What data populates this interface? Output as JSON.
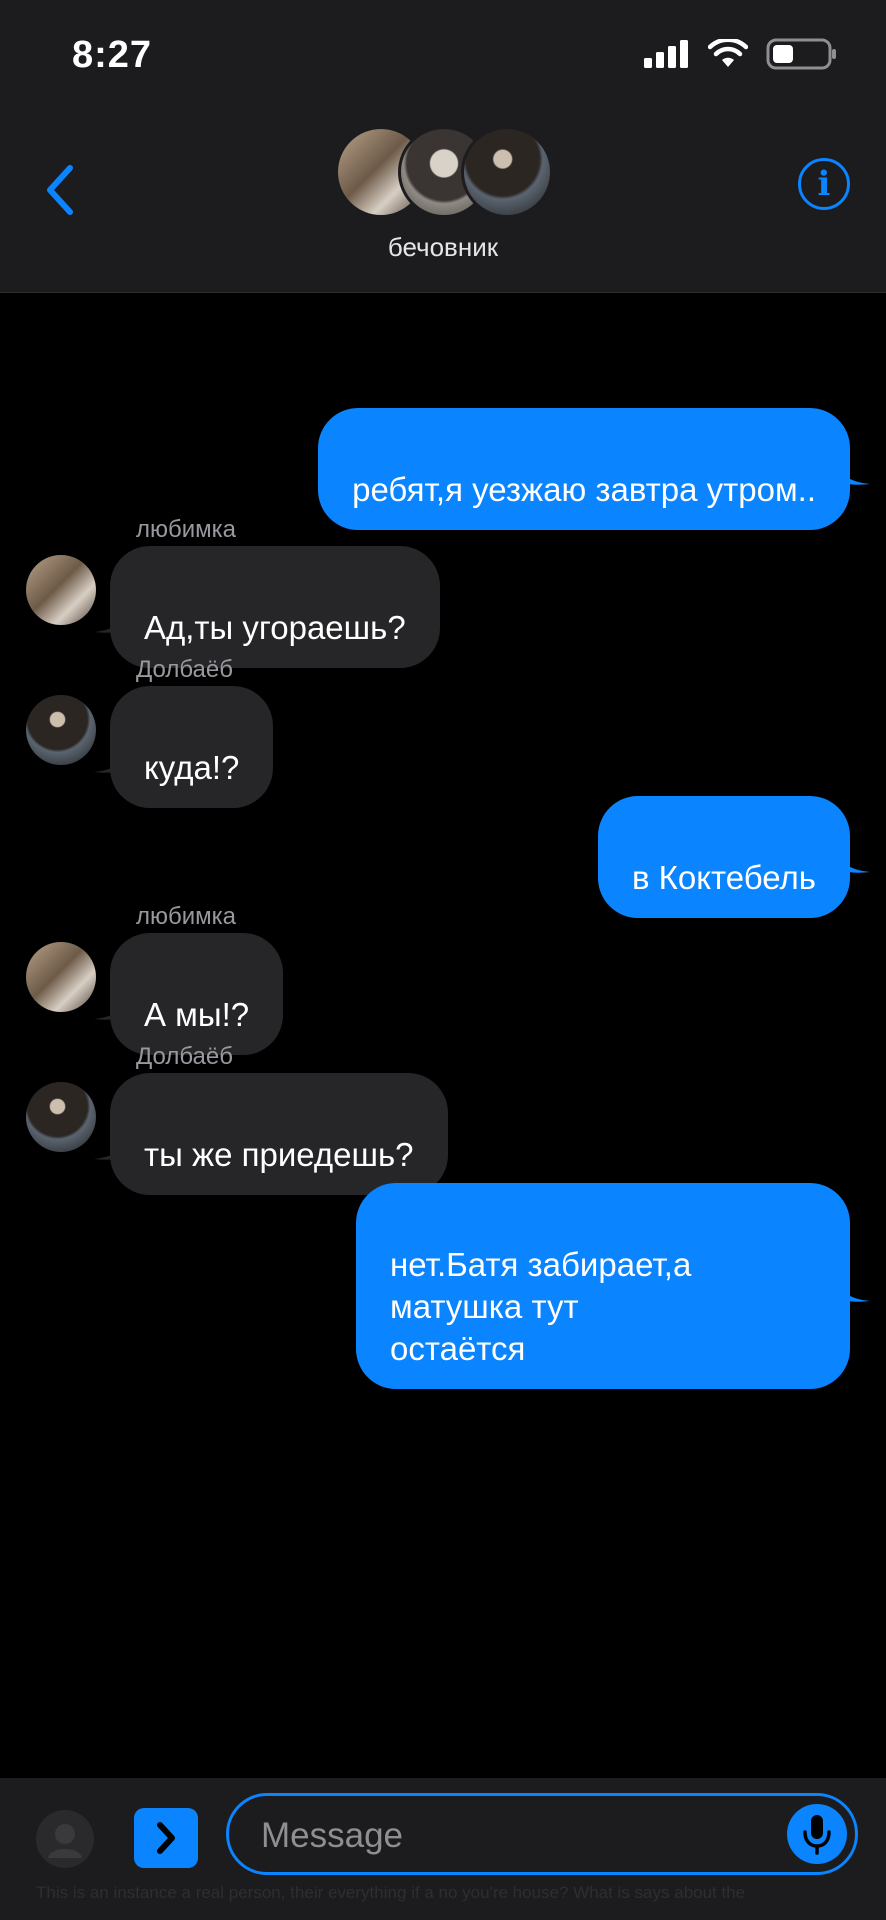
{
  "status": {
    "time": "8:27",
    "signal": "signal-icon",
    "wifi": "wifi-icon",
    "battery": "battery-icon"
  },
  "header": {
    "group_name": "бечовник",
    "back": "chevron-left-icon",
    "info": "i"
  },
  "messages": [
    {
      "direction": "outgoing",
      "text": "ребят,я уезжаю завтра утром.."
    },
    {
      "direction": "incoming",
      "sender": "любимка",
      "text": "Ад,ты угораешь?"
    },
    {
      "direction": "incoming",
      "sender": "Долбаёб",
      "text": "куда!?"
    },
    {
      "direction": "outgoing",
      "text": "в Коктебель"
    },
    {
      "direction": "incoming",
      "sender": "любимка",
      "text": "А мы!?"
    },
    {
      "direction": "incoming",
      "sender": "Долбаёб",
      "text": "ты же приедешь?"
    },
    {
      "direction": "outgoing",
      "text": "нет.Батя забирает,а матушка тут\nостаётся"
    }
  ],
  "composer": {
    "placeholder": "Message",
    "apps_icon": "chevron-right-icon",
    "mic_icon": "mic-icon"
  },
  "footnote": "This is an instance a real person, their everything if a no you're house? What is says about the",
  "colors": {
    "accent": "#0a84ff",
    "incoming_bubble": "#262628",
    "bar": "#1c1c1e"
  }
}
